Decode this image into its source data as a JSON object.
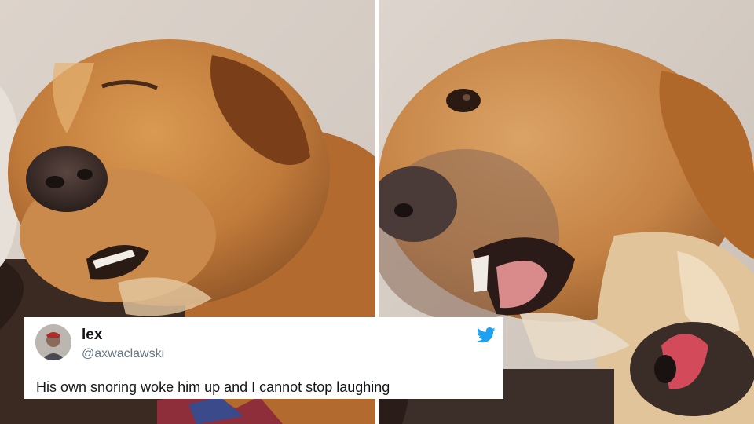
{
  "tweet": {
    "display_name": "lex",
    "handle": "@axwaclawski",
    "text": "His own snoring woke him up and I cannot stop laughing",
    "avatar_icon": "profile-photo",
    "brand_icon": "twitter-bird-icon",
    "brand_color": "#1da1f2"
  },
  "photos": {
    "left": {
      "subject": "sleeping-golden-dog"
    },
    "right": {
      "subject": "waking-golden-dog"
    }
  }
}
